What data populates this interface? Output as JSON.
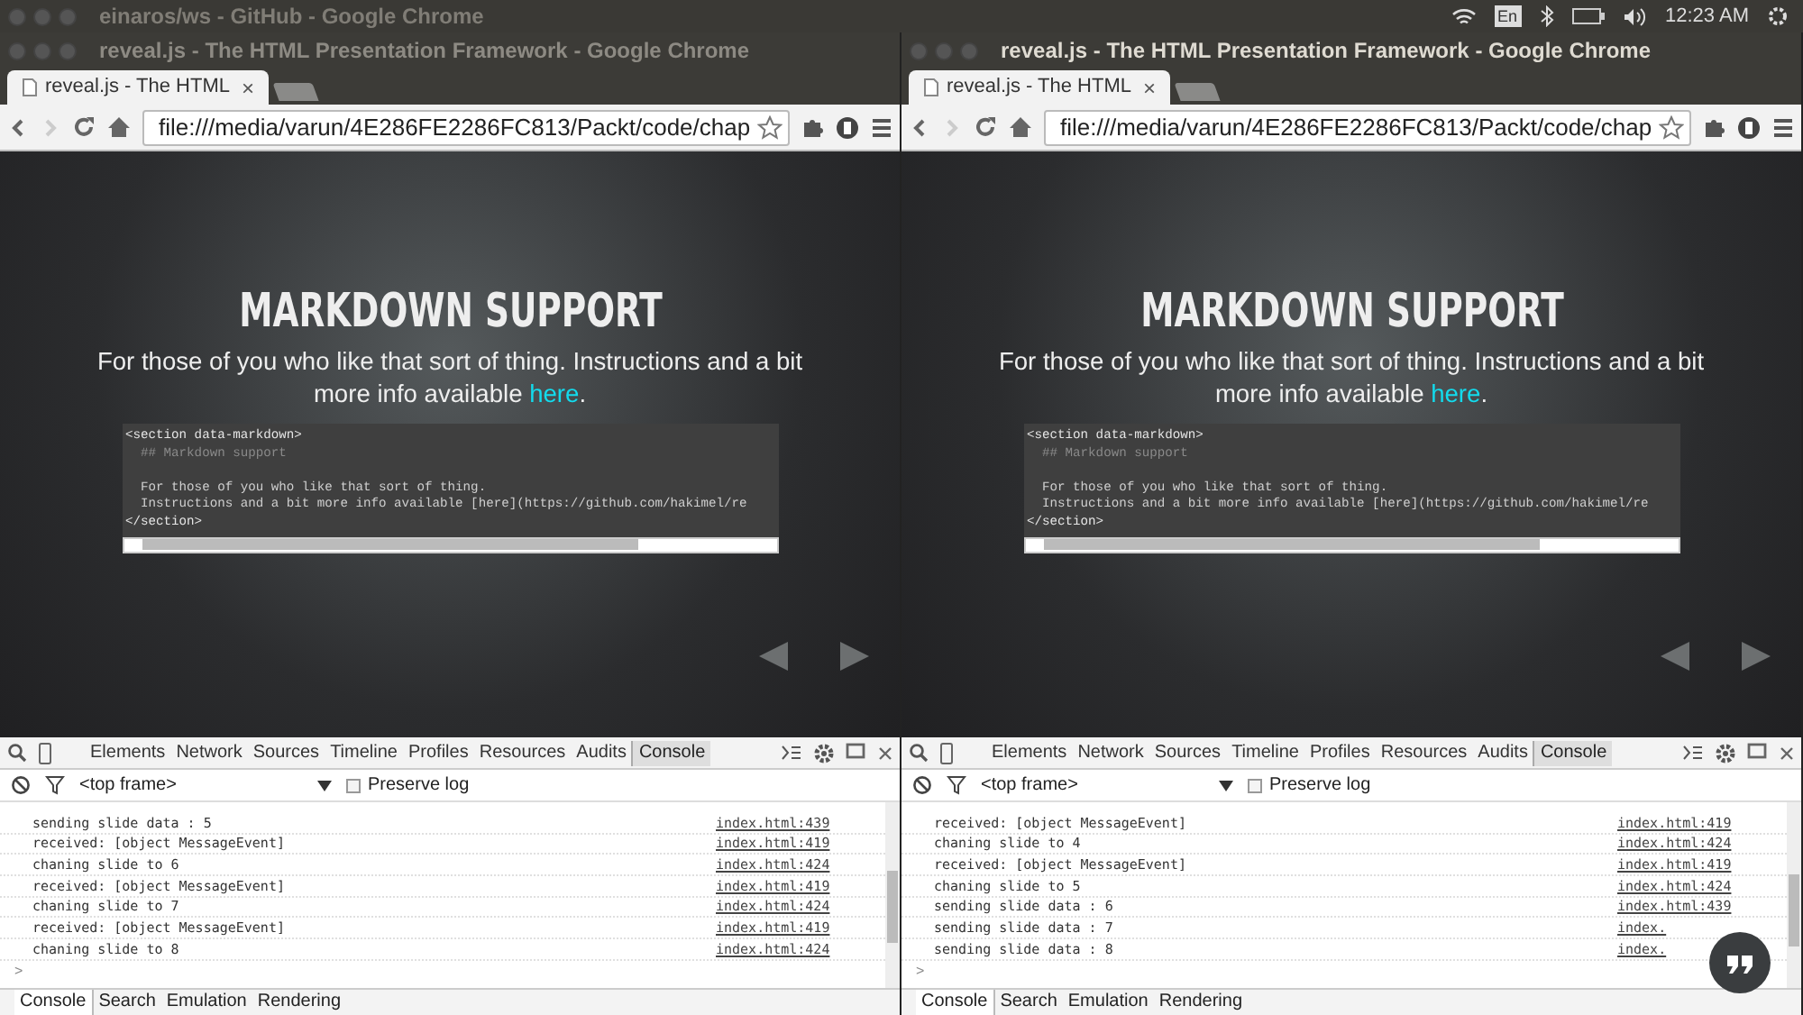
{
  "top_bar": {
    "background_title": "einaros/ws - GitHub - Google Chrome",
    "keyboard": "En",
    "clock": "12:23 AM"
  },
  "windows": [
    {
      "title": "reveal.js - The HTML Presentation Framework - Google Chrome",
      "active": false,
      "tab": "reveal.js - The HTML",
      "close": "×",
      "address": "file:///media/varun/4E286FE2286FC813/Packt/code/chap",
      "slide": {
        "heading": "MARKDOWN SUPPORT",
        "text": "For those of you who like that sort of thing. Instructions and a bit more info available ",
        "link": "here",
        "end": ".",
        "code": [
          {
            "kind": "tag",
            "text": "<section data-markdown>",
            "gap_before": false
          },
          {
            "kind": "comment",
            "text": "  ## Markdown support",
            "gap_before": false
          },
          {
            "kind": "text",
            "text": "  For those of you who like that sort of thing.",
            "gap_before": true
          },
          {
            "kind": "text",
            "text": "  Instructions and a bit more info available [here](https://github.com/hakimel/re",
            "gap_before": false
          },
          {
            "kind": "tag",
            "text": "</section>",
            "gap_before": false
          }
        ]
      },
      "devtools": {
        "tabs": [
          {
            "label": "Elements",
            "selected": false
          },
          {
            "label": "Network",
            "selected": false
          },
          {
            "label": "Sources",
            "selected": false
          },
          {
            "label": "Timeline",
            "selected": false
          },
          {
            "label": "Profiles",
            "selected": false
          },
          {
            "label": "Resources",
            "selected": false
          },
          {
            "label": "Audits",
            "selected": false
          },
          {
            "label": "Console",
            "selected": true
          }
        ],
        "frame": "<top frame>",
        "preserve_log": {
          "label": "Preserve log",
          "checked": false
        },
        "log": [
          {
            "message": "sending slide data : 5",
            "source": "index.html:439"
          },
          {
            "message": "received: [object MessageEvent]",
            "source": "index.html:419"
          },
          {
            "message": "chaning slide to 6",
            "source": "index.html:424"
          },
          {
            "message": "received: [object MessageEvent]",
            "source": "index.html:419"
          },
          {
            "message": "chaning slide to 7",
            "source": "index.html:424"
          },
          {
            "message": "received: [object MessageEvent]",
            "source": "index.html:419"
          },
          {
            "message": "chaning slide to 8",
            "source": "index.html:424"
          }
        ],
        "prompt": ">",
        "drawer_tabs": [
          {
            "label": "Console",
            "selected": true
          },
          {
            "label": "Search",
            "selected": false
          },
          {
            "label": "Emulation",
            "selected": false
          },
          {
            "label": "Rendering",
            "selected": false
          }
        ]
      }
    },
    {
      "title": "reveal.js - The HTML Presentation Framework - Google Chrome",
      "active": true,
      "tab": "reveal.js - The HTML",
      "close": "×",
      "address": "file:///media/varun/4E286FE2286FC813/Packt/code/chap",
      "slide": {
        "heading": "MARKDOWN SUPPORT",
        "text": "For those of you who like that sort of thing. Instructions and a bit more info available ",
        "link": "here",
        "end": ".",
        "code": [
          {
            "kind": "tag",
            "text": "<section data-markdown>",
            "gap_before": false
          },
          {
            "kind": "comment",
            "text": "  ## Markdown support",
            "gap_before": false
          },
          {
            "kind": "text",
            "text": "  For those of you who like that sort of thing.",
            "gap_before": true
          },
          {
            "kind": "text",
            "text": "  Instructions and a bit more info available [here](https://github.com/hakimel/re",
            "gap_before": false
          },
          {
            "kind": "tag",
            "text": "</section>",
            "gap_before": false
          }
        ]
      },
      "devtools": {
        "tabs": [
          {
            "label": "Elements",
            "selected": false
          },
          {
            "label": "Network",
            "selected": false
          },
          {
            "label": "Sources",
            "selected": false
          },
          {
            "label": "Timeline",
            "selected": false
          },
          {
            "label": "Profiles",
            "selected": false
          },
          {
            "label": "Resources",
            "selected": false
          },
          {
            "label": "Audits",
            "selected": false
          },
          {
            "label": "Console",
            "selected": true
          }
        ],
        "frame": "<top frame>",
        "preserve_log": {
          "label": "Preserve log",
          "checked": false
        },
        "log": [
          {
            "message": "received: [object MessageEvent]",
            "source": "index.html:419"
          },
          {
            "message": "chaning slide to 4",
            "source": "index.html:424"
          },
          {
            "message": "received: [object MessageEvent]",
            "source": "index.html:419"
          },
          {
            "message": "chaning slide to 5",
            "source": "index.html:424"
          },
          {
            "message": "sending slide data : 6",
            "source": "index.html:439"
          },
          {
            "message": "sending slide data : 7",
            "source": "index."
          },
          {
            "message": "sending slide data : 8",
            "source": "index."
          }
        ],
        "prompt": ">",
        "drawer_tabs": [
          {
            "label": "Console",
            "selected": true
          },
          {
            "label": "Search",
            "selected": false
          },
          {
            "label": "Emulation",
            "selected": false
          },
          {
            "label": "Rendering",
            "selected": false
          }
        ],
        "chat_head": true
      }
    }
  ]
}
